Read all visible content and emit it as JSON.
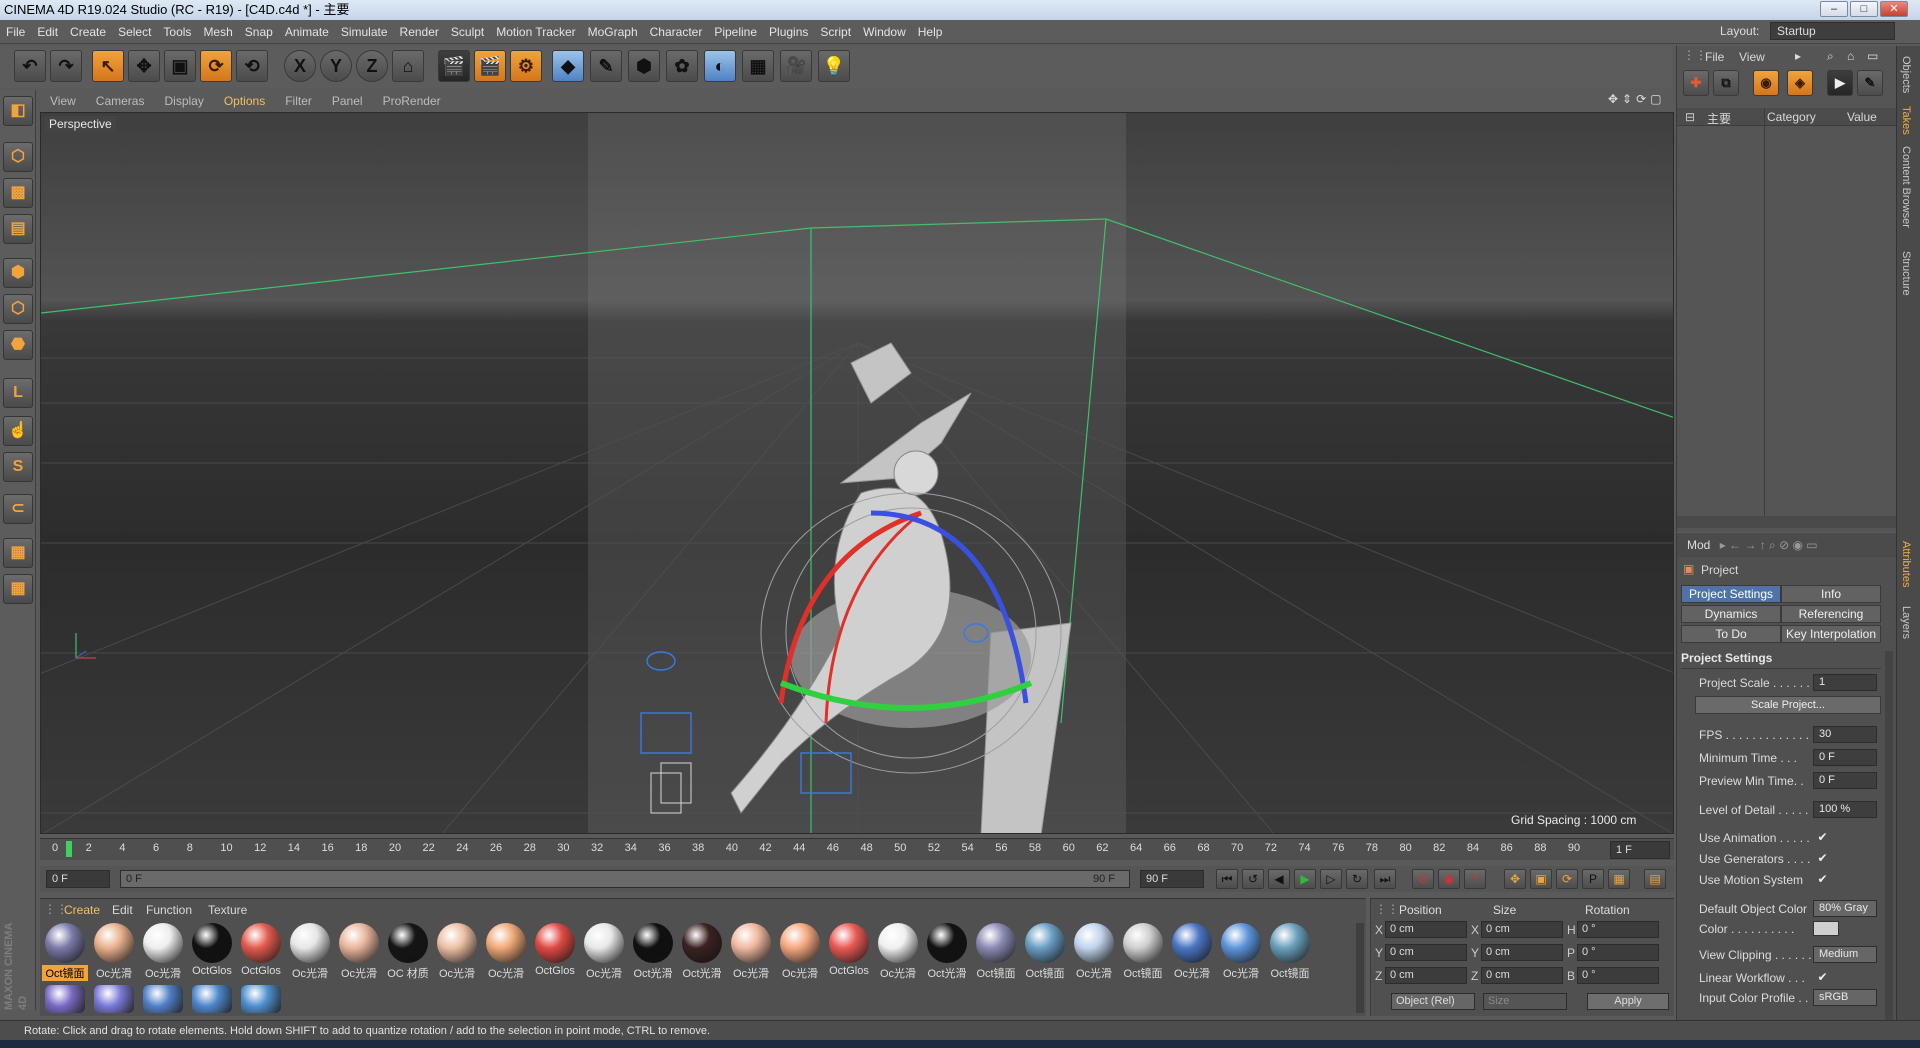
{
  "window": {
    "title": "CINEMA 4D R19.024 Studio (RC - R19) - [C4D.c4d *] - 主要",
    "controls": [
      "–",
      "□",
      "✕"
    ]
  },
  "menu": [
    "File",
    "Edit",
    "Create",
    "Select",
    "Tools",
    "Mesh",
    "Snap",
    "Animate",
    "Simulate",
    "Render",
    "Sculpt",
    "Motion Tracker",
    "MoGraph",
    "Character",
    "Pipeline",
    "Plugins",
    "Script",
    "Window",
    "Help"
  ],
  "layout": {
    "label": "Layout:",
    "value": "Startup"
  },
  "toolbar": {
    "buttons": [
      {
        "icon": "undo-icon",
        "glyph": "↶",
        "style": ""
      },
      {
        "icon": "redo-icon",
        "glyph": "↷",
        "style": ""
      },
      {
        "icon": "live-selection-icon",
        "glyph": "↖",
        "style": "orange"
      },
      {
        "icon": "move-icon",
        "glyph": "✥",
        "style": ""
      },
      {
        "icon": "scale-icon",
        "glyph": "▣",
        "style": ""
      },
      {
        "icon": "rotate-icon",
        "glyph": "⟳",
        "style": "orange"
      },
      {
        "icon": "recent-tool-icon",
        "glyph": "⟲",
        "style": ""
      },
      {
        "icon": "x-axis-icon",
        "glyph": "X",
        "style": "circ"
      },
      {
        "icon": "y-axis-icon",
        "glyph": "Y",
        "style": "circ"
      },
      {
        "icon": "z-axis-icon",
        "glyph": "Z",
        "style": "circ"
      },
      {
        "icon": "coordinate-system-icon",
        "glyph": "⌂",
        "style": ""
      },
      {
        "icon": "render-view-icon",
        "glyph": "🎬",
        "style": "dark"
      },
      {
        "icon": "render-picture-viewer-icon",
        "glyph": "🎬",
        "style": "orange"
      },
      {
        "icon": "render-settings-icon",
        "glyph": "⚙",
        "style": "orange"
      },
      {
        "icon": "cube-icon",
        "glyph": "◆",
        "style": "blue"
      },
      {
        "icon": "pen-icon",
        "glyph": "✎",
        "style": ""
      },
      {
        "icon": "subdivision-icon",
        "glyph": "⬢",
        "style": ""
      },
      {
        "icon": "cloner-icon",
        "glyph": "✿",
        "style": ""
      },
      {
        "icon": "deformer-icon",
        "glyph": "◐",
        "style": "blue"
      },
      {
        "icon": "floor-icon",
        "glyph": "▦",
        "style": ""
      },
      {
        "icon": "camera-icon",
        "glyph": "🎥",
        "style": ""
      },
      {
        "icon": "light-icon",
        "glyph": "💡",
        "style": ""
      }
    ]
  },
  "left_tools": [
    {
      "icon": "make-editable-icon",
      "glyph": "◧"
    },
    {
      "icon": "model-mode-icon",
      "glyph": "⬡"
    },
    {
      "icon": "texture-mode-icon",
      "glyph": "▩"
    },
    {
      "icon": "workplane-icon",
      "glyph": "▤"
    },
    {
      "icon": "points-mode-icon",
      "glyph": "⬢"
    },
    {
      "icon": "edges-mode-icon",
      "glyph": "⬡"
    },
    {
      "icon": "polygons-mode-icon",
      "glyph": "⬣"
    },
    {
      "icon": "axis-mode-icon",
      "glyph": "L"
    },
    {
      "icon": "tweak-mode-icon",
      "glyph": "☝"
    },
    {
      "icon": "solo-icon",
      "glyph": "S"
    },
    {
      "icon": "snap-icon",
      "glyph": "⊂"
    },
    {
      "icon": "workplane-lock-icon",
      "glyph": "▦"
    },
    {
      "icon": "quantize-icon",
      "glyph": "▦"
    }
  ],
  "brand": "MAXON CINEMA 4D",
  "viewport": {
    "menu": [
      "View",
      "Cameras",
      "Display",
      "Options",
      "Filter",
      "Panel",
      "ProRender"
    ],
    "highlighted": "Options",
    "label": "Perspective",
    "grid_spacing": "Grid Spacing : 1000 cm"
  },
  "object_manager": {
    "menu": [
      "File",
      "View"
    ],
    "root_item": "主要",
    "columns": [
      "Category",
      "Value"
    ]
  },
  "right_tabs": [
    "Objects",
    "Takes",
    "Content Browser",
    "Structure",
    "Attributes",
    "Layers"
  ],
  "attributes": {
    "mode_label": "Mod",
    "title": "Project",
    "tabs": [
      "Project Settings",
      "Info",
      "Dynamics",
      "Referencing",
      "To Do",
      "Key Interpolation"
    ],
    "section": "Project Settings",
    "rows": [
      {
        "label": "Project Scale . . . . . .",
        "value": "1"
      },
      {
        "label": "FPS . . . . . . . . . . . . . . .",
        "value": "30"
      },
      {
        "label": "Minimum Time . . .",
        "value": "0 F"
      },
      {
        "label": "Preview Min Time. .",
        "value": "0 F"
      },
      {
        "label": "Level of Detail . . . . .",
        "value": "100 %"
      },
      {
        "label": "Default Object Color",
        "value": "80% Gray"
      },
      {
        "label": "View Clipping . . . . . .",
        "value": "Medium"
      },
      {
        "label": "Input Color Profile . .",
        "value": "sRGB"
      }
    ],
    "scale_button": "Scale Project...",
    "checks": [
      {
        "label": "Use Animation . . . . .",
        "checked": "✔"
      },
      {
        "label": "Use Generators . . . .",
        "checked": "✔"
      },
      {
        "label": "Use Motion System",
        "checked": "✔"
      },
      {
        "label": "Linear Workflow . . .",
        "checked": "✔"
      }
    ],
    "color_label": "Color . . . . . . . . . ."
  },
  "timeline": {
    "ticks": [
      "0",
      "2",
      "4",
      "6",
      "8",
      "10",
      "12",
      "14",
      "16",
      "18",
      "20",
      "22",
      "24",
      "26",
      "28",
      "30",
      "32",
      "34",
      "36",
      "38",
      "40",
      "42",
      "44",
      "46",
      "48",
      "50",
      "52",
      "54",
      "56",
      "58",
      "60",
      "62",
      "64",
      "66",
      "68",
      "70",
      "72",
      "74",
      "76",
      "78",
      "80",
      "82",
      "84",
      "86",
      "88",
      "90"
    ],
    "current": "1 F",
    "start": "0 F",
    "range_start": "0 F",
    "range_end": "90 F",
    "end": "90 F"
  },
  "materials": {
    "menu": [
      "Create",
      "Edit",
      "Function",
      "Texture"
    ],
    "items": [
      {
        "name": "Oct镜面",
        "color": "#7a7aa8"
      },
      {
        "name": "Oc光滑",
        "color": "#e8b08c"
      },
      {
        "name": "Oc光滑",
        "color": "#eeeeee"
      },
      {
        "name": "OctGlos",
        "color": "#111111"
      },
      {
        "name": "OctGlos",
        "color": "#e25a4e"
      },
      {
        "name": "Oc光滑",
        "color": "#e6e6e6"
      },
      {
        "name": "Oc光滑",
        "color": "#e8b59c"
      },
      {
        "name": "OC 材质",
        "color": "#151515"
      },
      {
        "name": "Oc光滑",
        "color": "#ecc0a4"
      },
      {
        "name": "Oc光滑",
        "color": "#f0a878"
      },
      {
        "name": "OctGlos",
        "color": "#e04a44"
      },
      {
        "name": "Oc光滑",
        "color": "#e8e8e8"
      },
      {
        "name": "Oct光滑",
        "color": "#101010"
      },
      {
        "name": "Oct光滑",
        "color": "#3a2220"
      },
      {
        "name": "Oc光滑",
        "color": "#f0b8a0"
      },
      {
        "name": "Oc光滑",
        "color": "#f4a880"
      },
      {
        "name": "OctGlos",
        "color": "#e85a54"
      },
      {
        "name": "Oc光滑",
        "color": "#f0f0f0"
      },
      {
        "name": "Oct光滑",
        "color": "#121212"
      },
      {
        "name": "Oct镜面",
        "color": "#8a8ab4"
      },
      {
        "name": "Oct镜面",
        "color": "#6a9ec4"
      },
      {
        "name": "Oc光滑",
        "color": "#c0d4ec"
      },
      {
        "name": "Oct镜面",
        "color": "#cfcfcf"
      },
      {
        "name": "Oc光滑",
        "color": "#4a76c4"
      },
      {
        "name": "Oc光滑",
        "color": "#5e94dc"
      },
      {
        "name": "Oct镜面",
        "color": "#6aa0bc"
      }
    ],
    "row2": [
      {
        "name": "",
        "color": "#7a6ac4"
      },
      {
        "name": "",
        "color": "#7a78d8"
      },
      {
        "name": "",
        "color": "#5080c8"
      },
      {
        "name": "",
        "color": "#4e86cc"
      },
      {
        "name": "",
        "color": "#4e90d0"
      }
    ],
    "selected": "Oct镜面"
  },
  "coordinates": {
    "headers": [
      "Position",
      "Size",
      "Rotation"
    ],
    "rows": [
      {
        "axis": "X",
        "pos": "0 cm",
        "saxis": "X",
        "size": "0 cm",
        "raxis": "H",
        "rot": "0 °"
      },
      {
        "axis": "Y",
        "pos": "0 cm",
        "saxis": "Y",
        "size": "0 cm",
        "raxis": "P",
        "rot": "0 °"
      },
      {
        "axis": "Z",
        "pos": "0 cm",
        "saxis": "Z",
        "size": "0 cm",
        "raxis": "B",
        "rot": "0 °"
      }
    ],
    "mode": "Object (Rel)",
    "size_mode": "Size",
    "apply": "Apply"
  },
  "status": "Rotate: Click and drag to rotate elements. Hold down SHIFT to add to quantize rotation / add to the selection in point mode, CTRL to remove."
}
